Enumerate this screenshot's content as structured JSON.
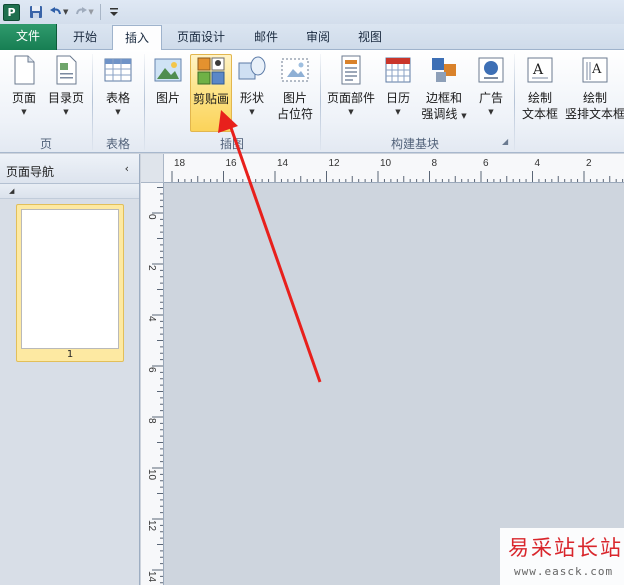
{
  "qat": {
    "app_letter": "P"
  },
  "tabs": [
    {
      "label": "文件"
    },
    {
      "label": "开始"
    },
    {
      "label": "插入"
    },
    {
      "label": "页面设计"
    },
    {
      "label": "邮件"
    },
    {
      "label": "审阅"
    },
    {
      "label": "视图"
    }
  ],
  "ribbon": {
    "groups": {
      "page": "页",
      "table": "表格",
      "illustrations": "插图",
      "building_blocks": "构建基块"
    },
    "buttons": {
      "page": "页面",
      "toc_page": "目录页",
      "table": "表格",
      "picture": "图片",
      "clipart": "剪贴画",
      "shapes": "形状",
      "picture_placeholder_1": "图片",
      "picture_placeholder_2": "占位符",
      "page_parts": "页面部件",
      "calendar": "日历",
      "borders_1": "边框和",
      "borders_2": "强调线",
      "ads": "广告",
      "draw_textbox_1": "绘制",
      "draw_textbox_2": "文本框",
      "draw_vtextbox_1": "绘制",
      "draw_vtextbox_2": "竖排文本框"
    }
  },
  "nav": {
    "title": "页面导航",
    "collapse_glyph": "‹",
    "section_glyph": "◢",
    "page_number": "1"
  },
  "rulers": {
    "h_labels": [
      "18",
      "16",
      "14",
      "12",
      "10",
      "8",
      "6",
      "4",
      "2"
    ],
    "v_labels": [
      "0",
      "2",
      "4",
      "6",
      "8",
      "10",
      "12",
      "14"
    ]
  },
  "watermark": {
    "title": "易采站长站",
    "url": "www.easck.com"
  },
  "colors": {
    "file_tab": "#177e53",
    "active_accent": "#fbd35a",
    "annotation_arrow": "#e8201c"
  }
}
